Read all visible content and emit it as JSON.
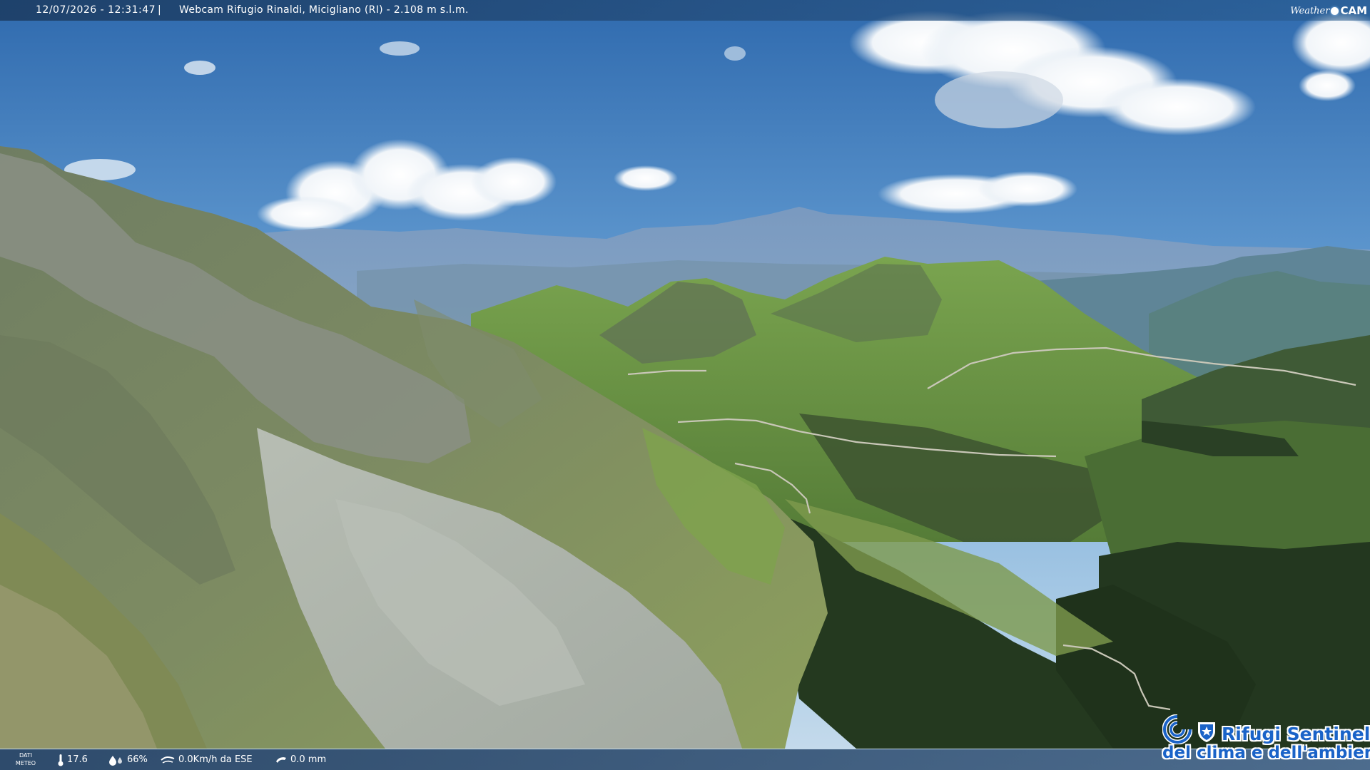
{
  "header": {
    "timestamp": "12/07/2026 - 12:31:47",
    "separator": "|",
    "title": "Webcam Rifugio Rinaldi, Micigliano (RI) - 2.108 m s.l.m.",
    "brand_logo": {
      "left": "Weather",
      "icon": "circle-dot-icon",
      "right": "CAM"
    }
  },
  "weather_bar": {
    "label_line1": "DATI",
    "label_line2": "METEO",
    "temperature": "17.6",
    "temperature_icon": "thermometer-icon",
    "humidity": "66%",
    "humidity_icon": "droplet-icon",
    "wind": "0.0Km/h da ESE",
    "wind_icon": "wind-icon",
    "rain": "0.0 mm",
    "rain_icon": "rain-gauge-icon"
  },
  "partner_logo": {
    "name": "Rifugi Sentinella",
    "tagline": "del clima e dell'ambiente",
    "icon": "cai-shield-icon"
  },
  "colors": {
    "sky_top": "#2f6eb4",
    "sky_horizon": "#a9cbe6",
    "grass": "#6f9a45",
    "rock": "#9aa39a",
    "forest": "#243b22",
    "logo_blue": "#1a63c8"
  }
}
